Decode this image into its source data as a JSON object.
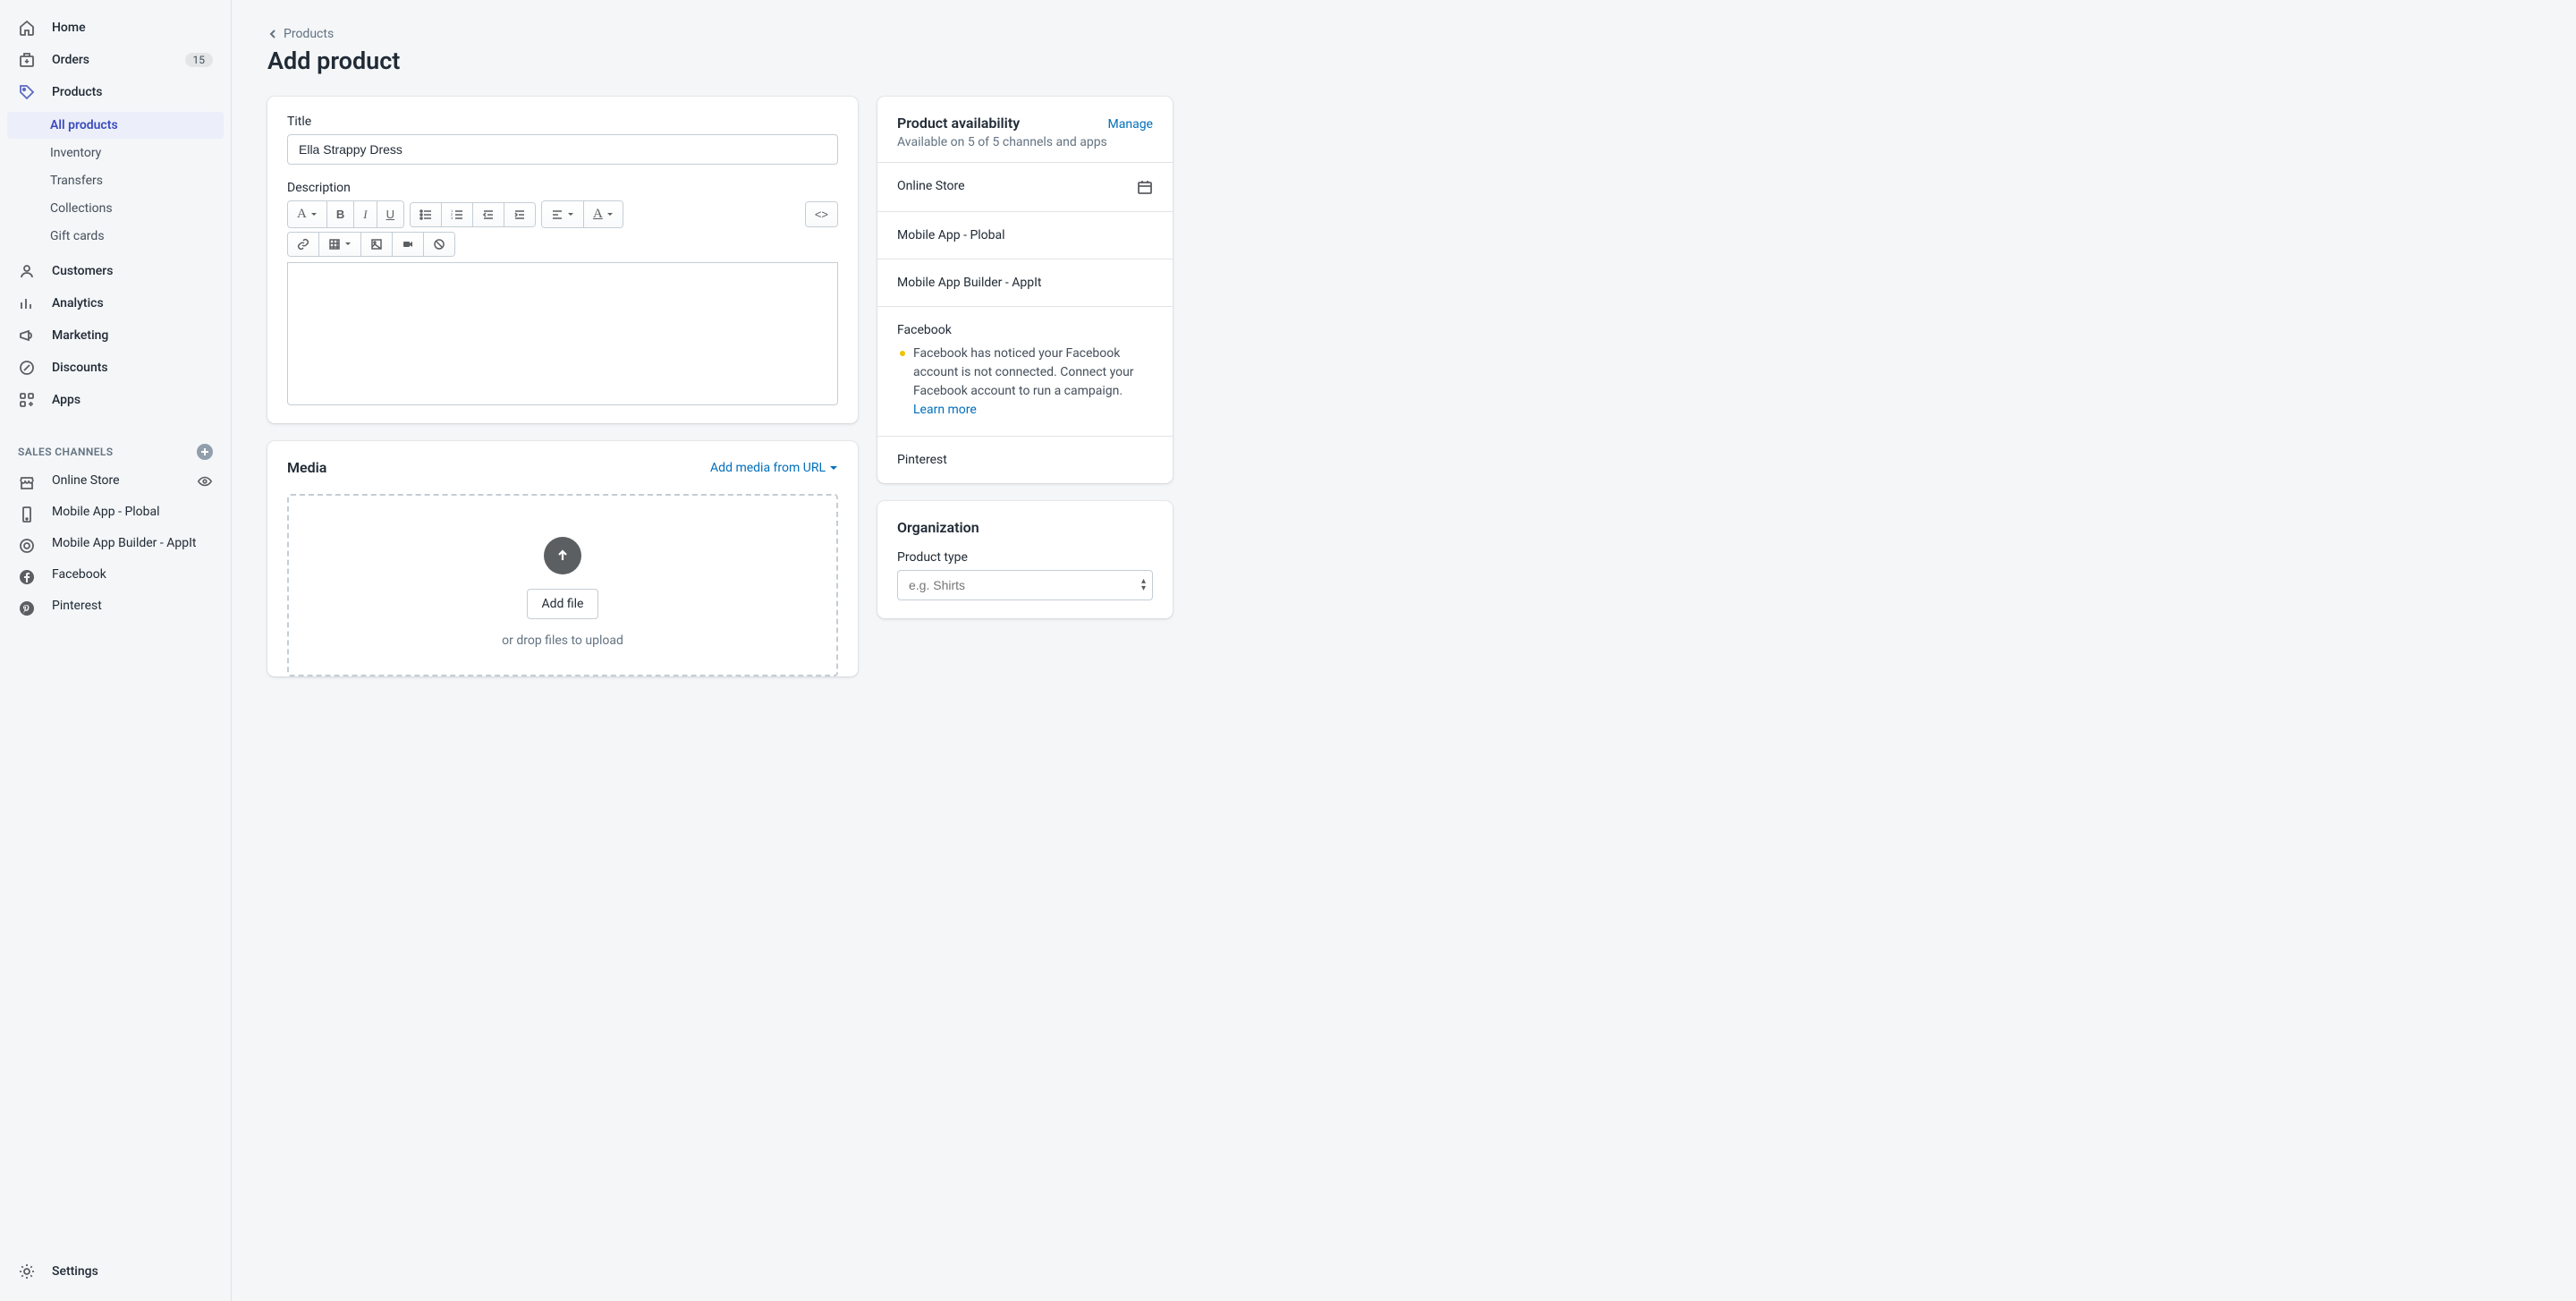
{
  "nav": {
    "home": "Home",
    "orders": "Orders",
    "orders_badge": "15",
    "products": "Products",
    "customers": "Customers",
    "analytics": "Analytics",
    "marketing": "Marketing",
    "discounts": "Discounts",
    "apps": "Apps",
    "settings": "Settings"
  },
  "products_sub": {
    "all": "All products",
    "inventory": "Inventory",
    "transfers": "Transfers",
    "collections": "Collections",
    "gift": "Gift cards"
  },
  "channels_header": "SALES CHANNELS",
  "channels": {
    "online": "Online Store",
    "plobal": "Mobile App - Plobal",
    "appit": "Mobile App Builder - AppIt",
    "fb": "Facebook",
    "pin": "Pinterest"
  },
  "breadcrumb": "Products",
  "page_title": "Add product",
  "form": {
    "title_label": "Title",
    "title_value": "Ella Strappy Dress",
    "desc_label": "Description"
  },
  "media": {
    "title": "Media",
    "add_url": "Add media from URL",
    "add_file": "Add file",
    "hint": "or drop files to upload"
  },
  "availability": {
    "title": "Product availability",
    "manage": "Manage",
    "sub": "Available on 5 of 5 channels and apps",
    "online": "Online Store",
    "plobal": "Mobile App - Plobal",
    "appit": "Mobile App Builder - AppIt",
    "fb": "Facebook",
    "fb_note": "Facebook has noticed your Facebook account is not connected. Connect your Facebook account to run a campaign. ",
    "learn": "Learn more",
    "pin": "Pinterest"
  },
  "org": {
    "title": "Organization",
    "type_label": "Product type",
    "type_placeholder": "e.g. Shirts"
  }
}
